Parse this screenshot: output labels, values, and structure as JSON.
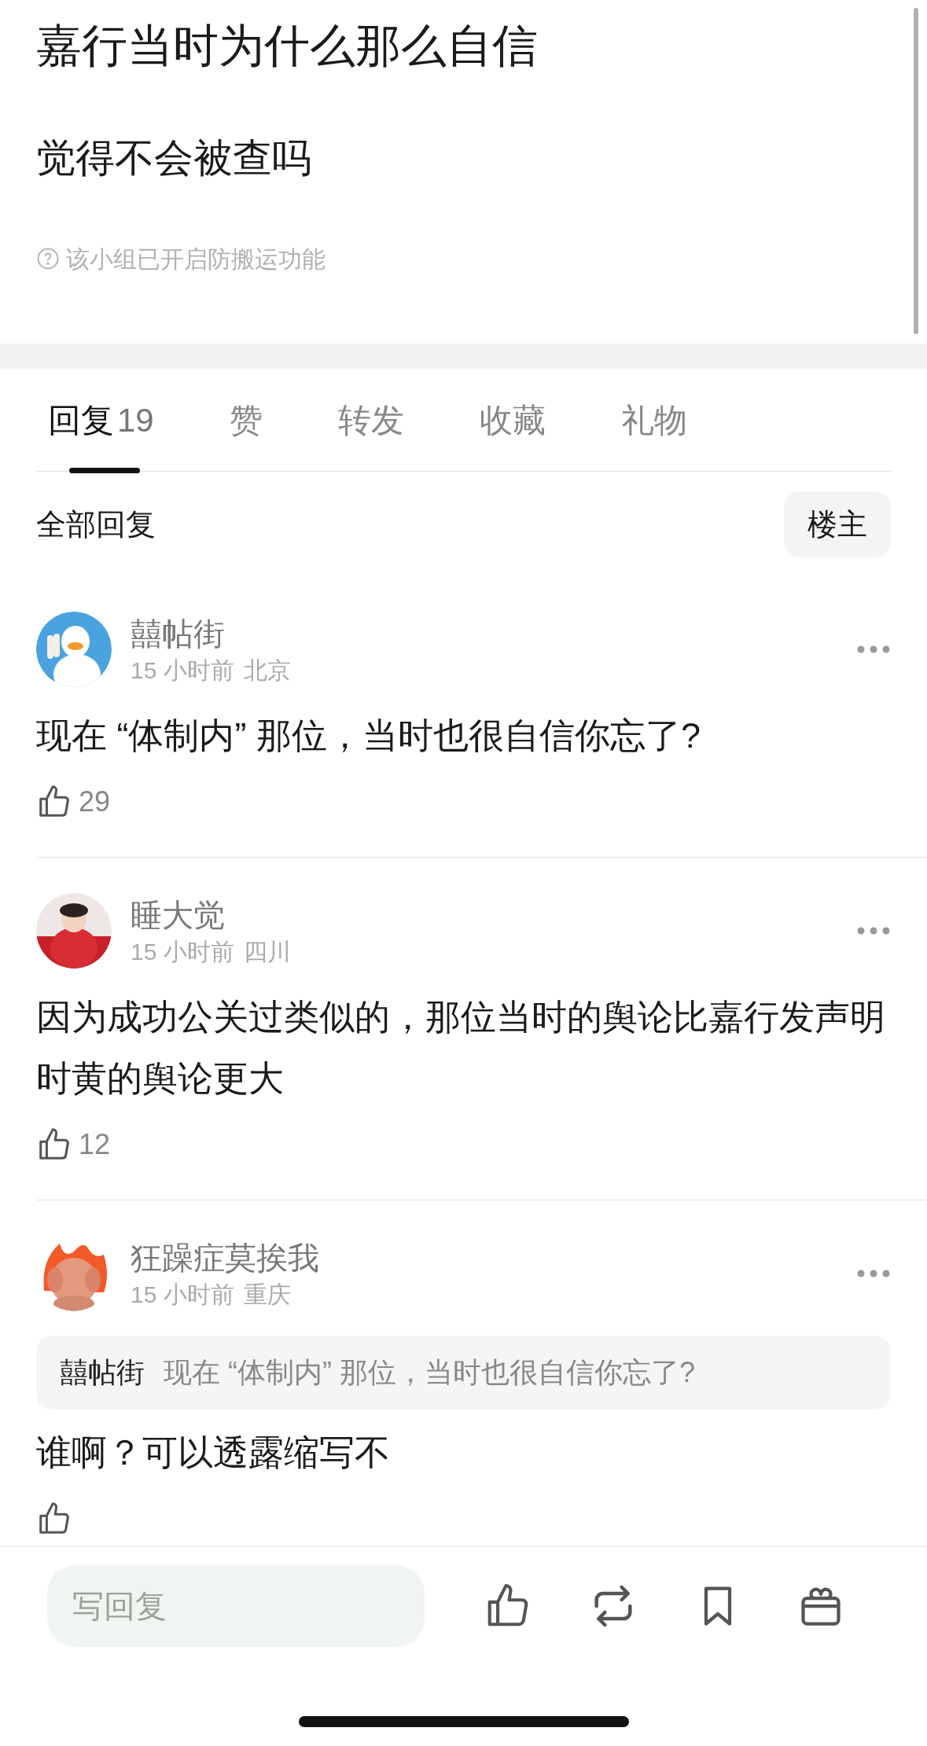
{
  "post": {
    "title": "嘉行当时为什么那么自信",
    "body": "觉得不会被查吗",
    "notice": "该小组已开启防搬运功能"
  },
  "tabs": [
    {
      "label": "回复",
      "count": "19",
      "selected": true
    },
    {
      "label": "赞",
      "selected": false
    },
    {
      "label": "转发",
      "selected": false
    },
    {
      "label": "收藏",
      "selected": false
    },
    {
      "label": "礼物",
      "selected": false
    }
  ],
  "filter": {
    "label": "全部回复",
    "button": "楼主"
  },
  "comments": [
    {
      "author": "囍帖街",
      "time": "15 小时前",
      "location": "北京",
      "text": "现在 “体制内” 那位，当时也很自信你忘了?",
      "likes": "29"
    },
    {
      "author": "睡大觉",
      "time": "15 小时前",
      "location": "四川",
      "text": "因为成功公关过类似的，那位当时的舆论比嘉行发声明时黄的舆论更大",
      "likes": "12"
    },
    {
      "author": "狂躁症莫挨我",
      "time": "15 小时前",
      "location": "重庆",
      "quote": {
        "author": "囍帖街",
        "text": "现在 “体制内” 那位，当时也很自信你忘了?"
      },
      "text": "谁啊？可以透露缩写不"
    }
  ],
  "reply_bar": {
    "placeholder": "写回复"
  }
}
